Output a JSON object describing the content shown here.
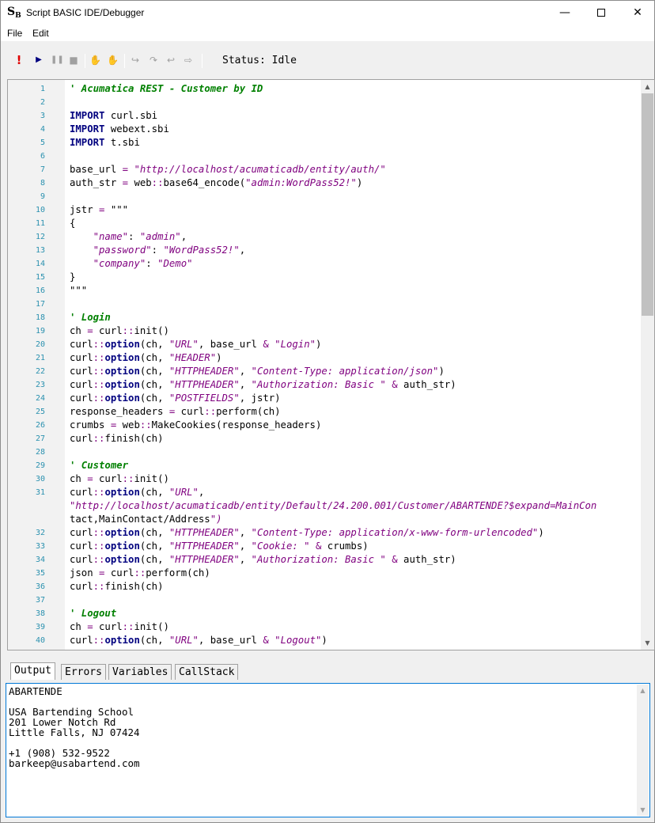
{
  "window": {
    "title": "Script BASIC IDE/Debugger",
    "logo": "S",
    "logo_sub": "B"
  },
  "menu": {
    "file": "File",
    "edit": "Edit"
  },
  "toolbar": {
    "status": "Status: Idle",
    "icons": [
      "run-icon",
      "step-icon",
      "pause-icon",
      "stop-icon",
      "hand-icon",
      "hand-stop-icon",
      "step-into-icon",
      "step-over-icon",
      "step-out-icon",
      "run-to-cursor-icon"
    ]
  },
  "editor": {
    "lines": [
      {
        "n": "1",
        "t": "' Acumatica REST - Customer by ID"
      },
      {
        "n": "2",
        "t": ""
      },
      {
        "n": "3",
        "t": "IMPORT curl.sbi"
      },
      {
        "n": "4",
        "t": "IMPORT webext.sbi"
      },
      {
        "n": "5",
        "t": "IMPORT t.sbi"
      },
      {
        "n": "6",
        "t": ""
      },
      {
        "n": "7",
        "t": "base_url = \"http://localhost/acumaticadb/entity/auth/\""
      },
      {
        "n": "8",
        "t": "auth_str = web::base64_encode(\"admin:WordPass52!\")"
      },
      {
        "n": "9",
        "t": ""
      },
      {
        "n": "10",
        "t": "jstr = \"\"\""
      },
      {
        "n": "11",
        "t": "{"
      },
      {
        "n": "12",
        "t": "    \"name\": \"admin\","
      },
      {
        "n": "13",
        "t": "    \"password\": \"WordPass52!\","
      },
      {
        "n": "14",
        "t": "    \"company\": \"Demo\""
      },
      {
        "n": "15",
        "t": "}"
      },
      {
        "n": "16",
        "t": "\"\"\""
      },
      {
        "n": "17",
        "t": ""
      },
      {
        "n": "18",
        "t": "' Login"
      },
      {
        "n": "19",
        "t": "ch = curl::init()"
      },
      {
        "n": "20",
        "t": "curl::option(ch, \"URL\", base_url & \"Login\")"
      },
      {
        "n": "21",
        "t": "curl::option(ch, \"HEADER\")"
      },
      {
        "n": "22",
        "t": "curl::option(ch, \"HTTPHEADER\", \"Content-Type: application/json\")"
      },
      {
        "n": "23",
        "t": "curl::option(ch, \"HTTPHEADER\", \"Authorization: Basic \" & auth_str)"
      },
      {
        "n": "24",
        "t": "curl::option(ch, \"POSTFIELDS\", jstr)"
      },
      {
        "n": "25",
        "t": "response_headers = curl::perform(ch)"
      },
      {
        "n": "26",
        "t": "crumbs = web::MakeCookies(response_headers)"
      },
      {
        "n": "27",
        "t": "curl::finish(ch)"
      },
      {
        "n": "28",
        "t": ""
      },
      {
        "n": "29",
        "t": "' Customer"
      },
      {
        "n": "30",
        "t": "ch = curl::init()"
      },
      {
        "n": "31",
        "t": "curl::option(ch, \"URL\","
      },
      {
        "n": "",
        "t": "\"http://localhost/acumaticadb/entity/Default/24.200.001/Customer/ABARTENDE?$expand=MainCon"
      },
      {
        "n": "",
        "t": "tact,MainContact/Address\")"
      },
      {
        "n": "32",
        "t": "curl::option(ch, \"HTTPHEADER\", \"Content-Type: application/x-www-form-urlencoded\")"
      },
      {
        "n": "33",
        "t": "curl::option(ch, \"HTTPHEADER\", \"Cookie: \" & crumbs)"
      },
      {
        "n": "34",
        "t": "curl::option(ch, \"HTTPHEADER\", \"Authorization: Basic \" & auth_str)"
      },
      {
        "n": "35",
        "t": "json = curl::perform(ch)"
      },
      {
        "n": "36",
        "t": "curl::finish(ch)"
      },
      {
        "n": "37",
        "t": ""
      },
      {
        "n": "38",
        "t": "' Logout"
      },
      {
        "n": "39",
        "t": "ch = curl::init()"
      },
      {
        "n": "40",
        "t": "curl::option(ch, \"URL\", base_url & \"Logout\")"
      }
    ]
  },
  "tabs": [
    "Output",
    "Errors",
    "Variables",
    "CallStack"
  ],
  "output": {
    "text": "ABARTENDE\n\nUSA Bartending School\n201 Lower Notch Rd\nLittle Falls, NJ 07424\n\n+1 (908) 532-9522\nbarkeep@usabartend.com"
  },
  "colors": {
    "comment": "#008000",
    "keyword": "#00007f",
    "string": "#7f007f",
    "line_number": "#2b91af",
    "run": "#e00000"
  }
}
